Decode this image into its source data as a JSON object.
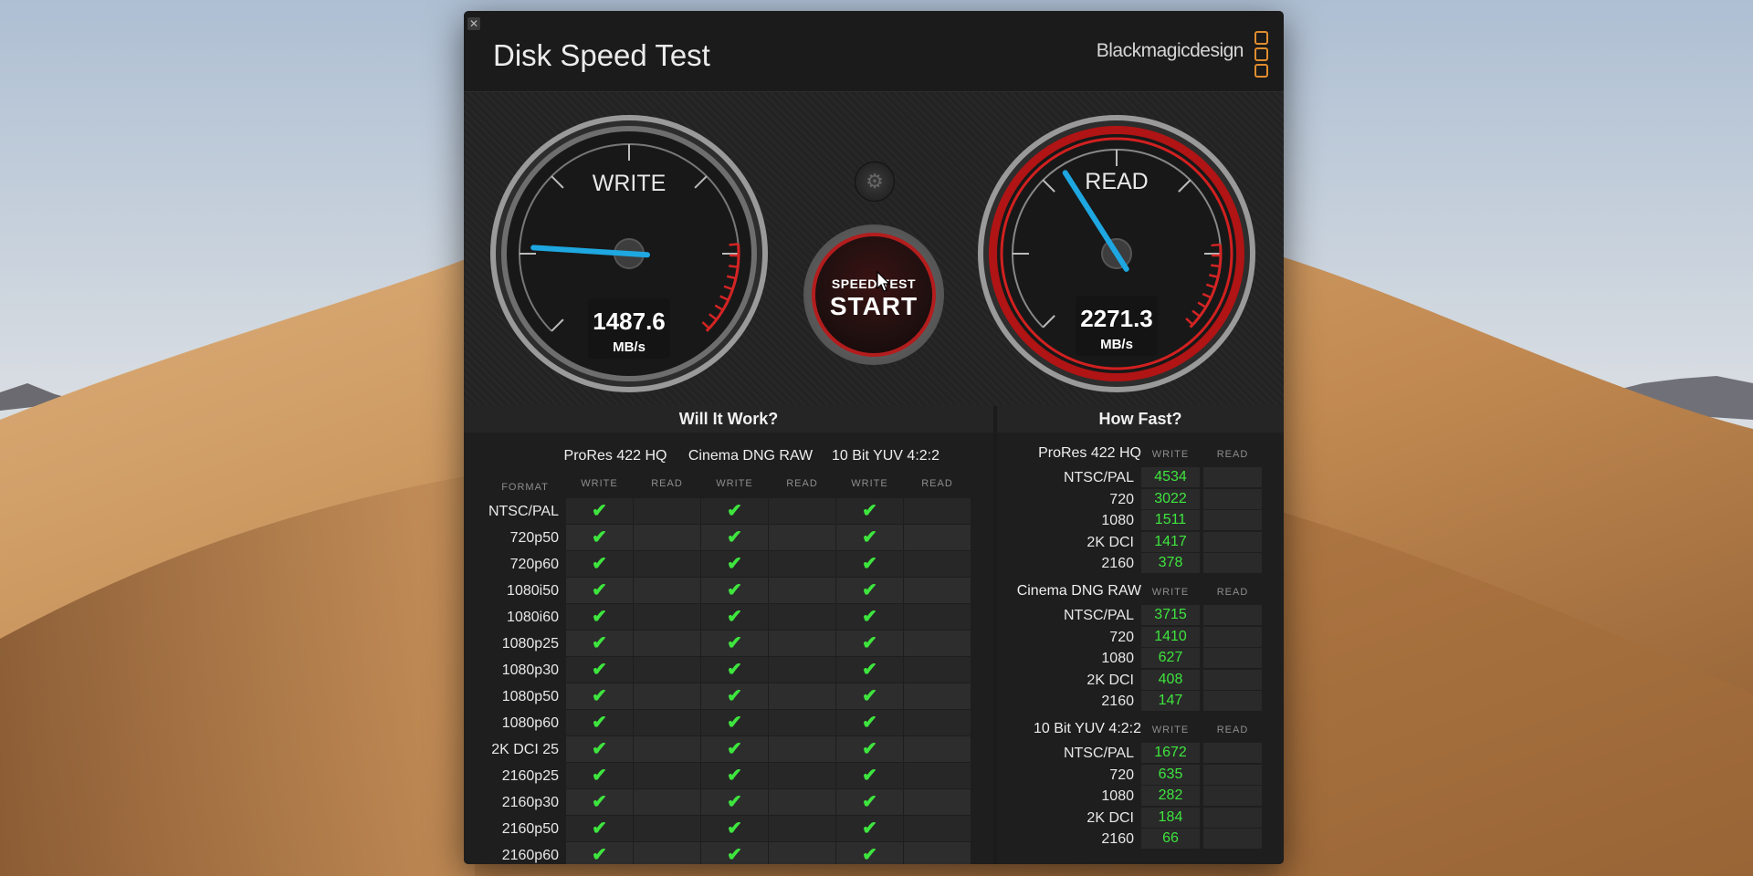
{
  "app": {
    "title": "Disk Speed Test",
    "brand": "Blackmagicdesign",
    "close_glyph": "✕"
  },
  "gauges": {
    "write": {
      "label": "WRITE",
      "value": "1487.6",
      "unit": "MB/s",
      "needle_fraction": 0.18
    },
    "read": {
      "label": "READ",
      "value": "2271.3",
      "unit": "MB/s",
      "needle_fraction": 0.38
    }
  },
  "controls": {
    "settings_icon": "gear-icon",
    "start_small": "SPEED TEST",
    "start_large": "START"
  },
  "will_it_work": {
    "title": "Will It Work?",
    "format_header": "FORMAT",
    "write_header": "WRITE",
    "read_header": "READ",
    "check": "✔",
    "groups": [
      "ProRes 422 HQ",
      "Cinema DNG RAW",
      "10 Bit YUV 4:2:2"
    ],
    "formats": [
      "NTSC/PAL",
      "720p50",
      "720p60",
      "1080i50",
      "1080i60",
      "1080p25",
      "1080p30",
      "1080p50",
      "1080p60",
      "2K DCI 25",
      "2160p25",
      "2160p30",
      "2160p50",
      "2160p60"
    ]
  },
  "how_fast": {
    "title": "How Fast?",
    "write_header": "WRITE",
    "read_header": "READ",
    "groups": [
      {
        "name": "ProRes 422 HQ",
        "rows": [
          {
            "format": "NTSC/PAL",
            "write": "4534"
          },
          {
            "format": "720",
            "write": "3022"
          },
          {
            "format": "1080",
            "write": "1511"
          },
          {
            "format": "2K DCI",
            "write": "1417"
          },
          {
            "format": "2160",
            "write": "378"
          }
        ]
      },
      {
        "name": "Cinema DNG RAW",
        "rows": [
          {
            "format": "NTSC/PAL",
            "write": "3715"
          },
          {
            "format": "720",
            "write": "1410"
          },
          {
            "format": "1080",
            "write": "627"
          },
          {
            "format": "2K DCI",
            "write": "408"
          },
          {
            "format": "2160",
            "write": "147"
          }
        ]
      },
      {
        "name": "10 Bit YUV 4:2:2",
        "rows": [
          {
            "format": "NTSC/PAL",
            "write": "1672"
          },
          {
            "format": "720",
            "write": "635"
          },
          {
            "format": "1080",
            "write": "282"
          },
          {
            "format": "2K DCI",
            "write": "184"
          },
          {
            "format": "2160",
            "write": "66"
          }
        ]
      }
    ]
  },
  "colors": {
    "accent_red": "#c41f1f",
    "needle_blue": "#1ea7e0",
    "check_green": "#3ee53e",
    "brand_orange": "#e08d2e"
  }
}
